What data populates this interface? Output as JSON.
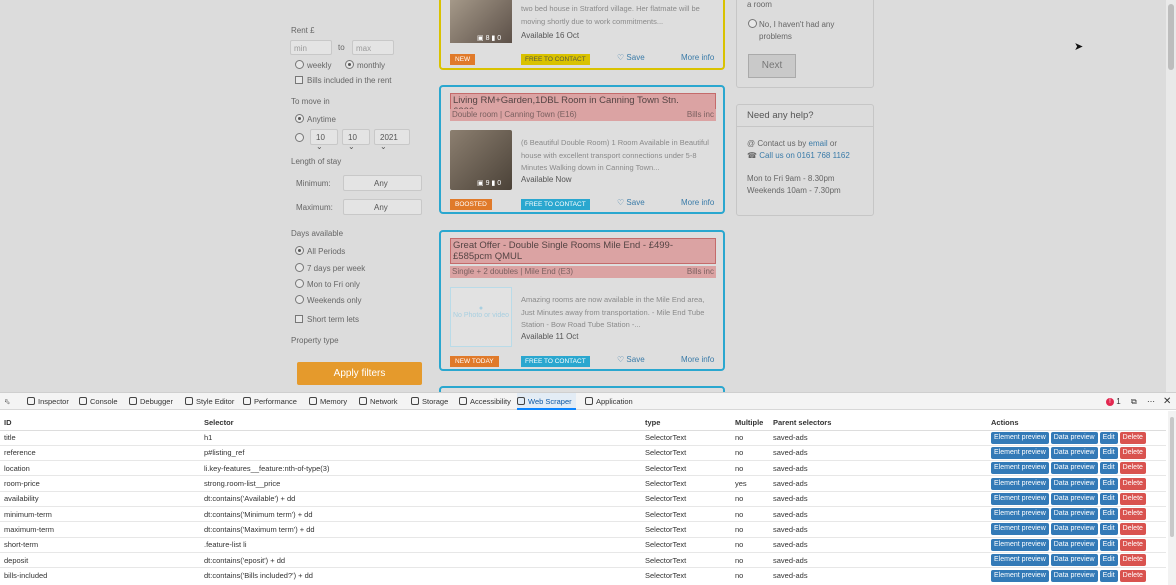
{
  "page": {
    "filters": {
      "rent_label": "Rent £",
      "min_placeholder": "min",
      "to_label": "to",
      "max_placeholder": "max",
      "weekly": "weekly",
      "monthly": "monthly",
      "bills_included": "Bills included in the rent",
      "move_in_label": "To move in",
      "anytime": "Anytime",
      "day_value": "10",
      "month_value": "10",
      "year_value": "2021",
      "length_label": "Length of stay",
      "minimum_label": "Minimum:",
      "maximum_label": "Maximum:",
      "min_stay_value": "Any",
      "max_stay_value": "Any",
      "days_label": "Days available",
      "all_periods": "All Periods",
      "seven_days": "7 days per week",
      "mon_fri": "Mon to Fri only",
      "weekends": "Weekends only",
      "short_term": "Short term lets",
      "property_type_label": "Property type",
      "apply_button": "Apply filters"
    },
    "listings": [
      {
        "desc": "two bed house in Stratford village. Her flatmate will be moving shortly due to work commitments...",
        "available": "Available 16 Oct",
        "photo_count": "8",
        "video_count": "0",
        "tag": "NEW",
        "contact": "FREE TO CONTACT",
        "save": "Save",
        "more": "More info"
      },
      {
        "title": "Living RM+Garden,1DBL Room in Canning Town Stn. £600pcm",
        "room_type": "Double room",
        "area": "Canning Town (E16)",
        "bills": "Bills inc",
        "desc": "(6 Beautiful Double Room) 1 Room Available in Beautiful house with excellent transport connections under 5-8 Minutes Walking down in Canning Town...",
        "available": "Available Now",
        "photo_count": "9",
        "video_count": "0",
        "tag": "BOOSTED",
        "contact": "FREE TO CONTACT",
        "save": "Save",
        "more": "More info"
      },
      {
        "title": "Great Offer - Double Single Rooms Mile End - £499- £585pcm QMUL",
        "room_type": "Single + 2 doubles",
        "area": "Mile End (E3)",
        "bills": "Bills inc",
        "nophoto": "No Photo or video",
        "desc": "Amazing rooms are now available in the Mile End area, Just Minutes away from transportation. - Mile End Tube Station - Bow Road Tube Station -...",
        "available": "Available 11 Oct",
        "tag": "NEW TODAY",
        "contact": "FREE TO CONTACT",
        "save": "Save",
        "more": "More info"
      }
    ],
    "right": {
      "a_room": "a room",
      "no_problems": "No, I haven't had any problems",
      "next_button": "Next",
      "help_title": "Need any help?",
      "contact_prefix": "Contact us by",
      "contact_email": "email",
      "contact_or": "or",
      "call_us": "Call us on 0161 768 1162",
      "hours_1": "Mon to Fri 9am - 8.30pm",
      "hours_2": "Weekends 10am - 7.30pm"
    }
  },
  "devtools": {
    "tabs": [
      "Inspector",
      "Console",
      "Debugger",
      "Style Editor",
      "Performance",
      "Memory",
      "Network",
      "Storage",
      "Accessibility",
      "Web Scraper",
      "Application"
    ],
    "active_tab": "Web Scraper",
    "error_count": "1",
    "columns": [
      "ID",
      "Selector",
      "type",
      "Multiple",
      "Parent selectors",
      "Actions"
    ],
    "actions": [
      "Element preview",
      "Data preview",
      "Edit",
      "Delete"
    ],
    "rows": [
      [
        "title",
        "h1",
        "SelectorText",
        "no",
        "saved-ads"
      ],
      [
        "reference",
        "p#listing_ref",
        "SelectorText",
        "no",
        "saved-ads"
      ],
      [
        "location",
        "li.key-features__feature:nth-of-type(3)",
        "SelectorText",
        "no",
        "saved-ads"
      ],
      [
        "room-price",
        "strong.room-list__price",
        "SelectorText",
        "yes",
        "saved-ads"
      ],
      [
        "availability",
        "dt:contains('Available') + dd",
        "SelectorText",
        "no",
        "saved-ads"
      ],
      [
        "minimum-term",
        "dt:contains('Minimum term') + dd",
        "SelectorText",
        "no",
        "saved-ads"
      ],
      [
        "maximum-term",
        "dt:contains('Maximum term') + dd",
        "SelectorText",
        "no",
        "saved-ads"
      ],
      [
        "short-term",
        ".feature-list li",
        "SelectorText",
        "no",
        "saved-ads"
      ],
      [
        "deposit",
        "dt:contains('eposit') + dd",
        "SelectorText",
        "no",
        "saved-ads"
      ],
      [
        "bills-included",
        "dt:contains('Bills included?') + dd",
        "SelectorText",
        "no",
        "saved-ads"
      ]
    ]
  }
}
